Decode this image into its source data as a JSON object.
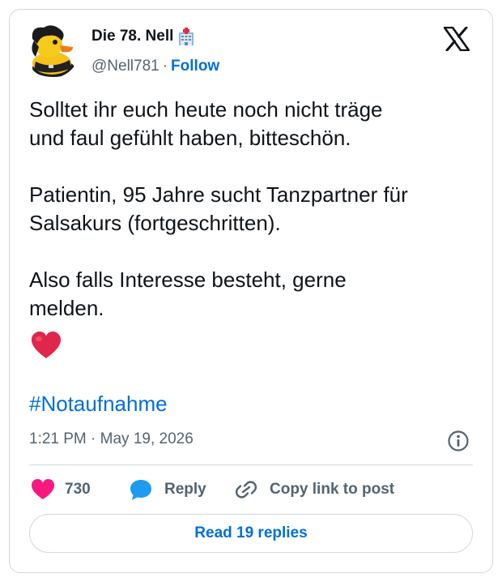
{
  "colors": {
    "link": "#006fd6",
    "text": "#0f1419",
    "secondary": "#536471",
    "border": "#cfd9de",
    "like": "#f91880",
    "reply": "#1d9bf0",
    "heart_emoji": "#e0264a"
  },
  "author": {
    "display_name": "Die 78. Nell",
    "name_emoji": "hospital-icon",
    "handle": "@Nell781",
    "separator": "·",
    "follow_label": "Follow",
    "avatar": "rubber-duck-avatar"
  },
  "platform_icon": "x-logo-icon",
  "tweet": {
    "text": "Solltet ihr euch heute noch nicht träge\nund faul gefühlt haben, bitteschön.\n\nPatientin, 95 Jahre sucht Tanzpartner für\nSalsakurs (fortgeschritten).\n\nAlso falls Interesse besteht, gerne\nmelden.",
    "emoji": "red-heart-icon",
    "hashtag": "#Notaufnahme",
    "timestamp": "1:21 PM · May 19, 2026"
  },
  "actions": {
    "like_count": "730",
    "reply_label": "Reply",
    "copy_link_label": "Copy link to post"
  },
  "read_replies_label": "Read 19 replies"
}
